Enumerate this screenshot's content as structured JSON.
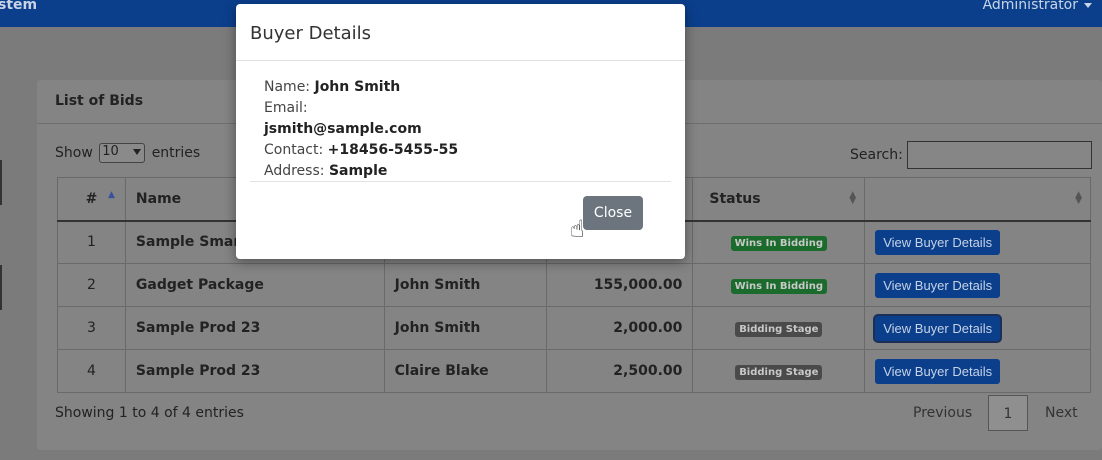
{
  "header": {
    "brand_fragment": "stem",
    "user_menu": "Administrator"
  },
  "card": {
    "title": "List of Bids",
    "show_label": "Show",
    "entries_value": "10",
    "entries_label": "entries",
    "search_label": "Search:",
    "search_value": "",
    "columns": [
      "#",
      "Name",
      "",
      "",
      "Status",
      ""
    ],
    "rows": [
      {
        "num": "1",
        "name": "Sample Smart",
        "buyer": "",
        "amount": "",
        "status": "Wins In Bidding",
        "action": "View Buyer Details"
      },
      {
        "num": "2",
        "name": "Gadget Package",
        "buyer": "John Smith",
        "amount": "155,000.00",
        "status": "Wins In Bidding",
        "action": "View Buyer Details"
      },
      {
        "num": "3",
        "name": "Sample Prod 23",
        "buyer": "John Smith",
        "amount": "2,000.00",
        "status": "Bidding Stage",
        "action": "View Buyer Details"
      },
      {
        "num": "4",
        "name": "Sample Prod 23",
        "buyer": "Claire Blake",
        "amount": "2,500.00",
        "status": "Bidding Stage",
        "action": "View Buyer Details"
      }
    ],
    "footer_info": "Showing 1 to 4 of 4 entries",
    "pagination": {
      "prev": "Previous",
      "page": "1",
      "next": "Next"
    }
  },
  "modal": {
    "title": "Buyer Details",
    "name_label": "Name:",
    "name_value": "John Smith",
    "email_label": "Email:",
    "email_value": "jsmith@sample.com",
    "contact_label": "Contact:",
    "contact_value": "+18456-5455-55",
    "address_label": "Address:",
    "address_value": "Sample",
    "close_label": "Close"
  },
  "icons": {
    "cursor": "hand-pointer-icon",
    "sort": "sort-icon",
    "dropdown": "caret-down-icon"
  },
  "colors": {
    "topbar": "#0b3f8c",
    "primary_button": "#0b3f8c",
    "win_badge": "#1a6b2c",
    "stage_badge": "#4a4a4a",
    "close_button": "#6c757d"
  }
}
